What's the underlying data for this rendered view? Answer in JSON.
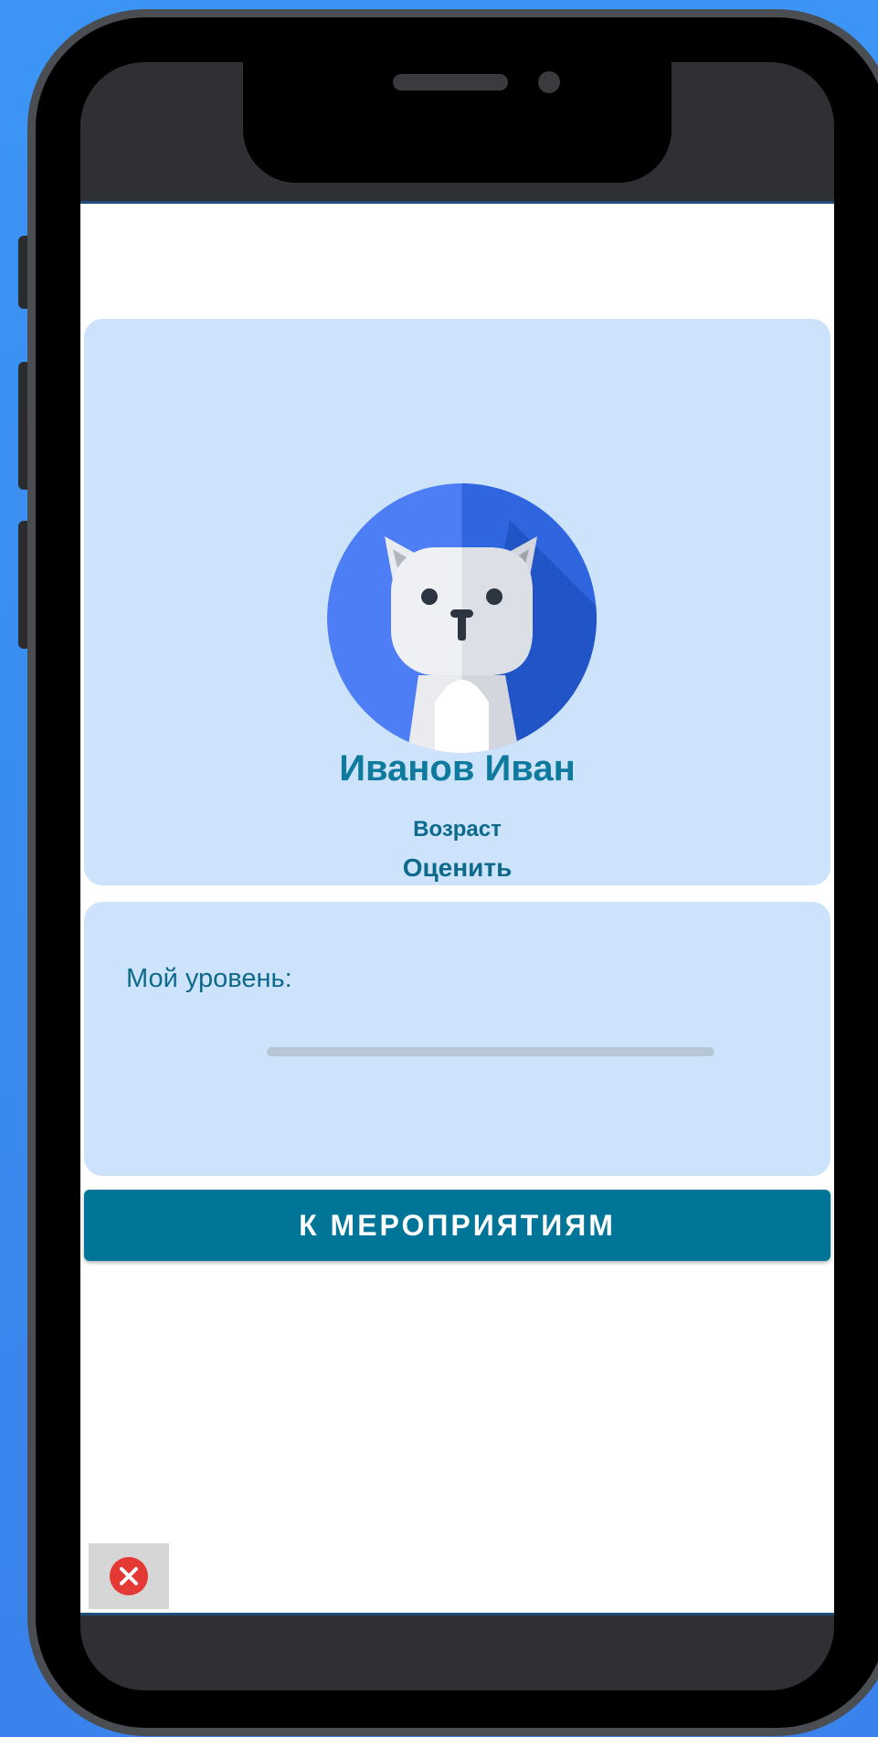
{
  "profile": {
    "name": "Иванов Иван",
    "age_label": "Возраст",
    "rate_link": "Оценить"
  },
  "level": {
    "label": "Мой уровень:",
    "progress_percent": 0
  },
  "actions": {
    "events_button": "К МЕРОПРИЯТИЯМ"
  },
  "icons": {
    "avatar": "cat-avatar-icon",
    "close": "close-icon"
  },
  "colors": {
    "accent": "#007597",
    "card_background": "#cde3fb",
    "name_text": "#0e7a9e",
    "close_icon": "#e53935"
  }
}
